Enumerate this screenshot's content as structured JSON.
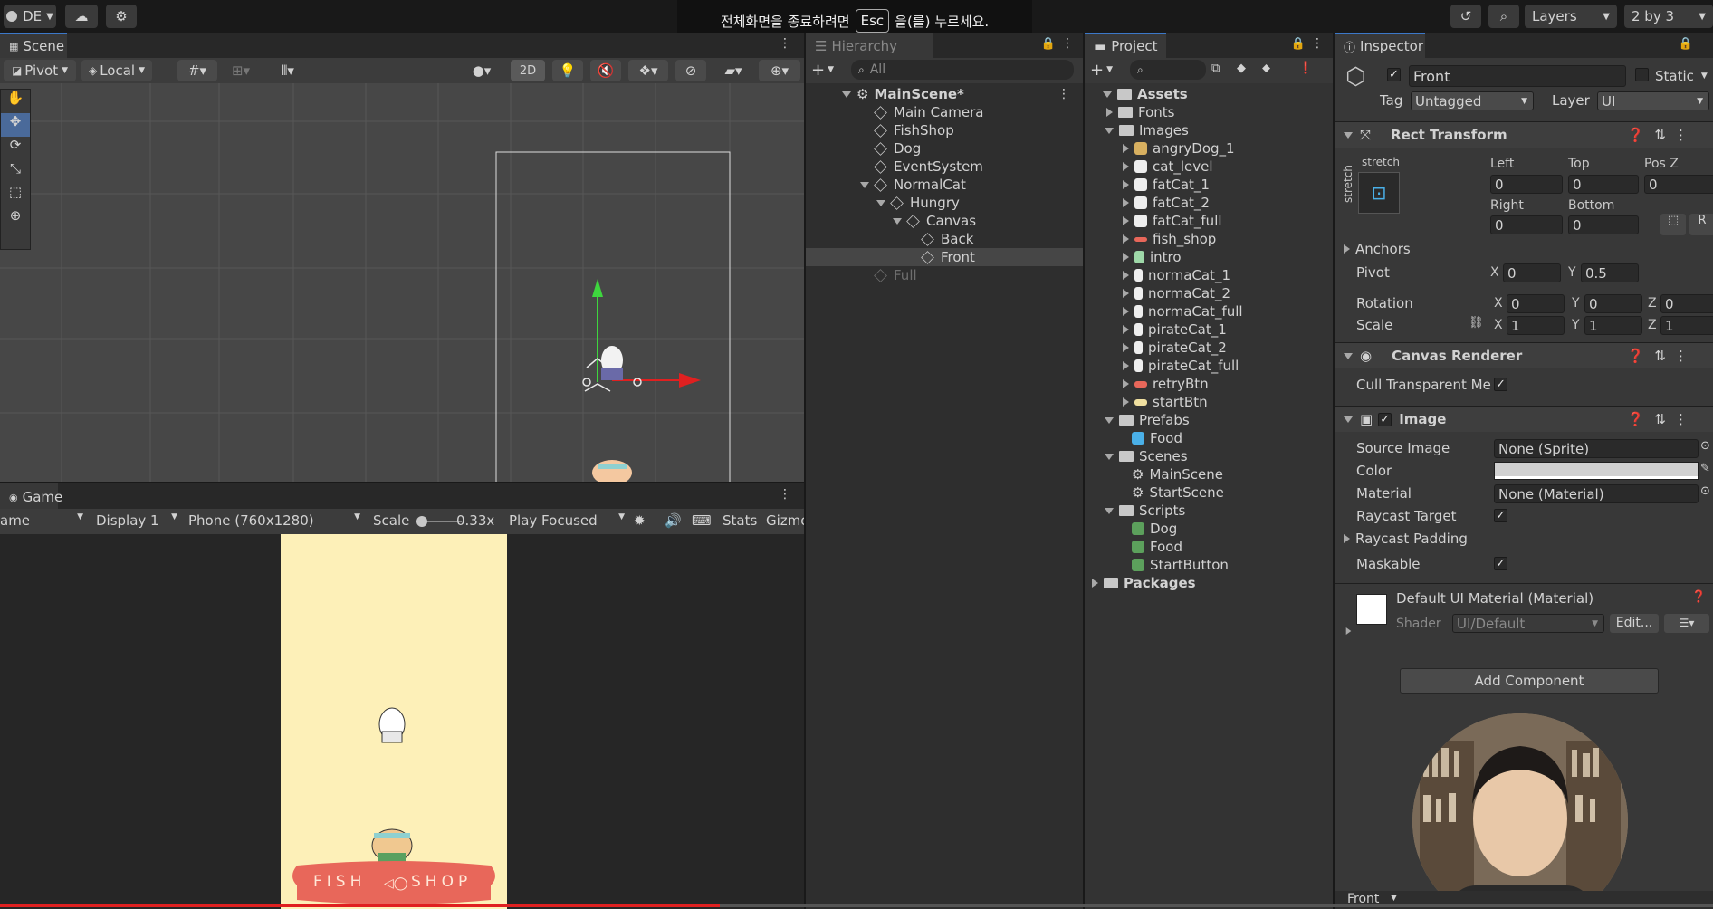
{
  "toolbar": {
    "account_label": "DE",
    "fullscreen_msg_prefix": "전체화면을 종료하려면",
    "fullscreen_msg_key": "Esc",
    "fullscreen_msg_suffix": "을(를) 누르세요.",
    "layers_label": "Layers",
    "layout_label": "2 by 3"
  },
  "scene": {
    "tab_label": "Scene",
    "pivot_label": "Pivot",
    "local_label": "Local",
    "mode_2d": "2D"
  },
  "game": {
    "tab_label": "Game",
    "view_label": "ame",
    "display_label": "Display 1",
    "resolution_label": "Phone (760x1280)",
    "scale_label": "Scale",
    "scale_value": "0.33x",
    "play_mode_label": "Play Focused",
    "stats_label": "Stats",
    "gizmos_label": "Gizmo",
    "shop_text": "FISH",
    "shop_text2": "SHOP"
  },
  "hierarchy": {
    "tab_label": "Hierarchy",
    "search_placeholder": "All",
    "items": [
      {
        "label": "MainScene*",
        "depth": 0
      },
      {
        "label": "Main Camera",
        "depth": 1
      },
      {
        "label": "FishShop",
        "depth": 1
      },
      {
        "label": "Dog",
        "depth": 1
      },
      {
        "label": "EventSystem",
        "depth": 1
      },
      {
        "label": "NormalCat",
        "depth": 1
      },
      {
        "label": "Hungry",
        "depth": 2
      },
      {
        "label": "Canvas",
        "depth": 3
      },
      {
        "label": "Back",
        "depth": 4
      },
      {
        "label": "Front",
        "depth": 4
      },
      {
        "label": "Full",
        "depth": 1
      }
    ]
  },
  "project": {
    "tab_label": "Project",
    "items": [
      {
        "label": "Assets",
        "depth": 0
      },
      {
        "label": "Fonts",
        "depth": 1
      },
      {
        "label": "Images",
        "depth": 1
      },
      {
        "label": "angryDog_1",
        "depth": 2
      },
      {
        "label": "cat_level",
        "depth": 2
      },
      {
        "label": "fatCat_1",
        "depth": 2
      },
      {
        "label": "fatCat_2",
        "depth": 2
      },
      {
        "label": "fatCat_full",
        "depth": 2
      },
      {
        "label": "fish_shop",
        "depth": 2
      },
      {
        "label": "intro",
        "depth": 2
      },
      {
        "label": "normaCat_1",
        "depth": 2
      },
      {
        "label": "normaCat_2",
        "depth": 2
      },
      {
        "label": "normaCat_full",
        "depth": 2
      },
      {
        "label": "pirateCat_1",
        "depth": 2
      },
      {
        "label": "pirateCat_2",
        "depth": 2
      },
      {
        "label": "pirateCat_full",
        "depth": 2
      },
      {
        "label": "retryBtn",
        "depth": 2
      },
      {
        "label": "startBtn",
        "depth": 2
      },
      {
        "label": "Prefabs",
        "depth": 1
      },
      {
        "label": "Food",
        "depth": 2
      },
      {
        "label": "Scenes",
        "depth": 1
      },
      {
        "label": "MainScene",
        "depth": 2
      },
      {
        "label": "StartScene",
        "depth": 2
      },
      {
        "label": "Scripts",
        "depth": 1
      },
      {
        "label": "Dog",
        "depth": 2
      },
      {
        "label": "Food",
        "depth": 2
      },
      {
        "label": "StartButton",
        "depth": 2
      },
      {
        "label": "Packages",
        "depth": 0
      }
    ]
  },
  "inspector": {
    "tab_label": "Inspector",
    "object_name": "Front",
    "static_label": "Static",
    "tag_label": "Tag",
    "tag_value": "Untagged",
    "layer_label": "Layer",
    "layer_value": "UI",
    "rect_transform": {
      "title": "Rect Transform",
      "stretch_label": "stretch",
      "left_label": "Left",
      "left_value": "0",
      "top_label": "Top",
      "top_value": "0",
      "posz_label": "Pos Z",
      "posz_value": "0",
      "right_label": "Right",
      "right_value": "0",
      "bottom_label": "Bottom",
      "bottom_value": "0",
      "anchors_label": "Anchors",
      "pivot_label": "Pivot",
      "pivot_x": "0",
      "pivot_y": "0.5",
      "rotation_label": "Rotation",
      "rot_x": "0",
      "rot_y": "0",
      "rot_z": "0",
      "scale_label": "Scale",
      "scale_x": "1",
      "scale_y": "1",
      "scale_z": "1",
      "x": "X",
      "y": "Y",
      "z": "Z"
    },
    "canvas_renderer": {
      "title": "Canvas Renderer",
      "cull_label": "Cull Transparent Me"
    },
    "image": {
      "title": "Image",
      "source_label": "Source Image",
      "source_value": "None (Sprite)",
      "color_label": "Color",
      "material_label": "Material",
      "material_value": "None (Material)",
      "raycast_label": "Raycast Target",
      "raycast_padding_label": "Raycast Padding",
      "maskable_label": "Maskable"
    },
    "material": {
      "title": "Default UI Material (Material)",
      "shader_label": "Shader",
      "shader_value": "UI/Default",
      "edit_label": "Edit..."
    },
    "add_component_label": "Add Component",
    "footer_label": "Front"
  },
  "colors": {
    "accent": "#3c78c8",
    "game_bg": "#fdf0b8",
    "shop_red": "#e8675a"
  }
}
